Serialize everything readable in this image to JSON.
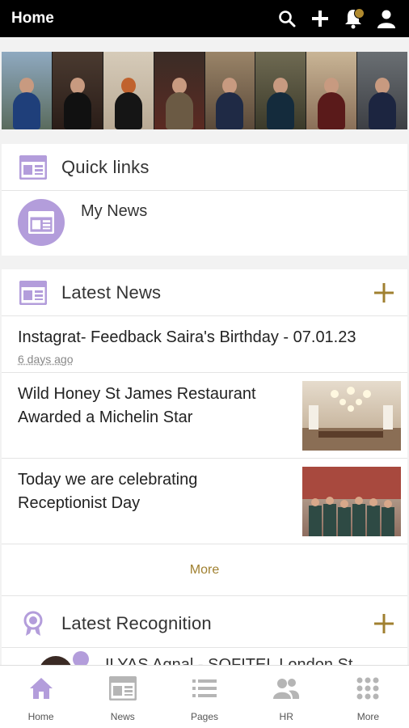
{
  "header": {
    "title": "Home"
  },
  "quick_links": {
    "title": "Quick links",
    "items": [
      {
        "label": "My News"
      }
    ]
  },
  "latest_news": {
    "title": "Latest News",
    "items": [
      {
        "title": "Instagrat- Feedback Saira's Birthday - 07.01.23",
        "meta": "6 days ago"
      },
      {
        "title": "Wild Honey St James Restaurant Awarded a Michelin Star"
      },
      {
        "title": "Today we are celebrating Receptionist Day"
      }
    ],
    "more_label": "More"
  },
  "latest_recognition": {
    "title": "Latest Recognition",
    "first_item": "ILYAS Agnal - SOFITEL London St"
  },
  "bottom_nav": [
    {
      "label": "Home",
      "icon": "home-icon",
      "active": true
    },
    {
      "label": "News",
      "icon": "news-icon"
    },
    {
      "label": "Pages",
      "icon": "pages-icon"
    },
    {
      "label": "HR",
      "icon": "people-icon"
    },
    {
      "label": "More",
      "icon": "grid-icon"
    }
  ],
  "colors": {
    "accent": "#b39ddb",
    "gold": "#a08030",
    "topbar": "#000000"
  }
}
